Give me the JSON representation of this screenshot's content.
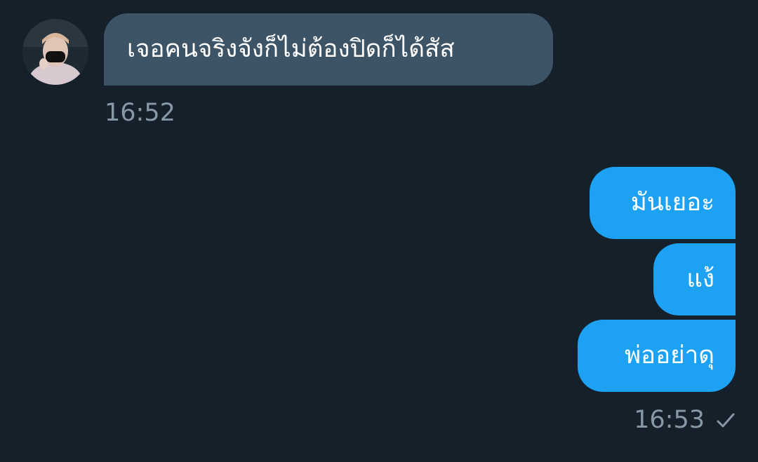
{
  "conversation": {
    "incoming": {
      "avatar_icon": "contact-avatar",
      "message": "เจอคนจริงจังก็ไม่ต้องปิดก็ได้สัส",
      "time": "16:52"
    },
    "outgoing": {
      "messages": [
        "มันเยอะ",
        "แง้",
        "พ่ออย่าดุ"
      ],
      "time": "16:53",
      "status_icon": "check-icon"
    }
  },
  "colors": {
    "background": "#15202b",
    "incoming_bubble": "#3d5466",
    "outgoing_bubble": "#1da1f2",
    "timestamp": "#8899a6"
  }
}
